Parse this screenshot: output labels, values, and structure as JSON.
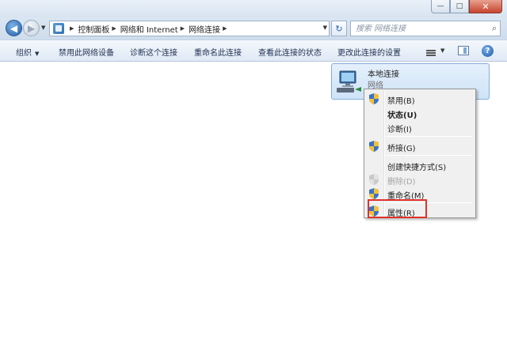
{
  "window": {
    "minimize_glyph": "—",
    "maximize_glyph": "□",
    "close_glyph": "✕"
  },
  "nav": {
    "back_glyph": "◀",
    "forward_glyph": "▶",
    "breadcrumb": [
      "控制面板",
      "网络和 Internet",
      "网络连接"
    ],
    "refresh_glyph": "↻",
    "search_placeholder": "搜索 网络连接"
  },
  "toolbar": {
    "organize": "组织",
    "disable_device": "禁用此网络设备",
    "diagnose": "诊断这个连接",
    "rename": "重命名此连接",
    "view_status": "查看此连接的状态",
    "change_settings": "更改此连接的设置",
    "help_glyph": "?"
  },
  "connection": {
    "name": "本地连接",
    "status": "网络"
  },
  "context_menu": {
    "items": [
      {
        "label": "禁用(B)",
        "icon": "shield-icon"
      },
      {
        "label": "状态(U)",
        "icon": "none",
        "bold": true
      },
      {
        "label": "诊断(I)",
        "icon": "none"
      },
      {
        "label": "桥接(G)",
        "icon": "shield-icon"
      },
      {
        "label": "创建快捷方式(S)",
        "icon": "none"
      },
      {
        "label": "删除(D)",
        "icon": "shield-icon",
        "disabled": true
      },
      {
        "label": "重命名(M)",
        "icon": "shield-icon"
      },
      {
        "label": "属性(R)",
        "icon": "shield-icon",
        "highlighted": true
      }
    ]
  },
  "colors": {
    "accent": "#1f5ea8",
    "highlight_border": "#e0312b",
    "tile_bg": "#d9e9fa"
  }
}
